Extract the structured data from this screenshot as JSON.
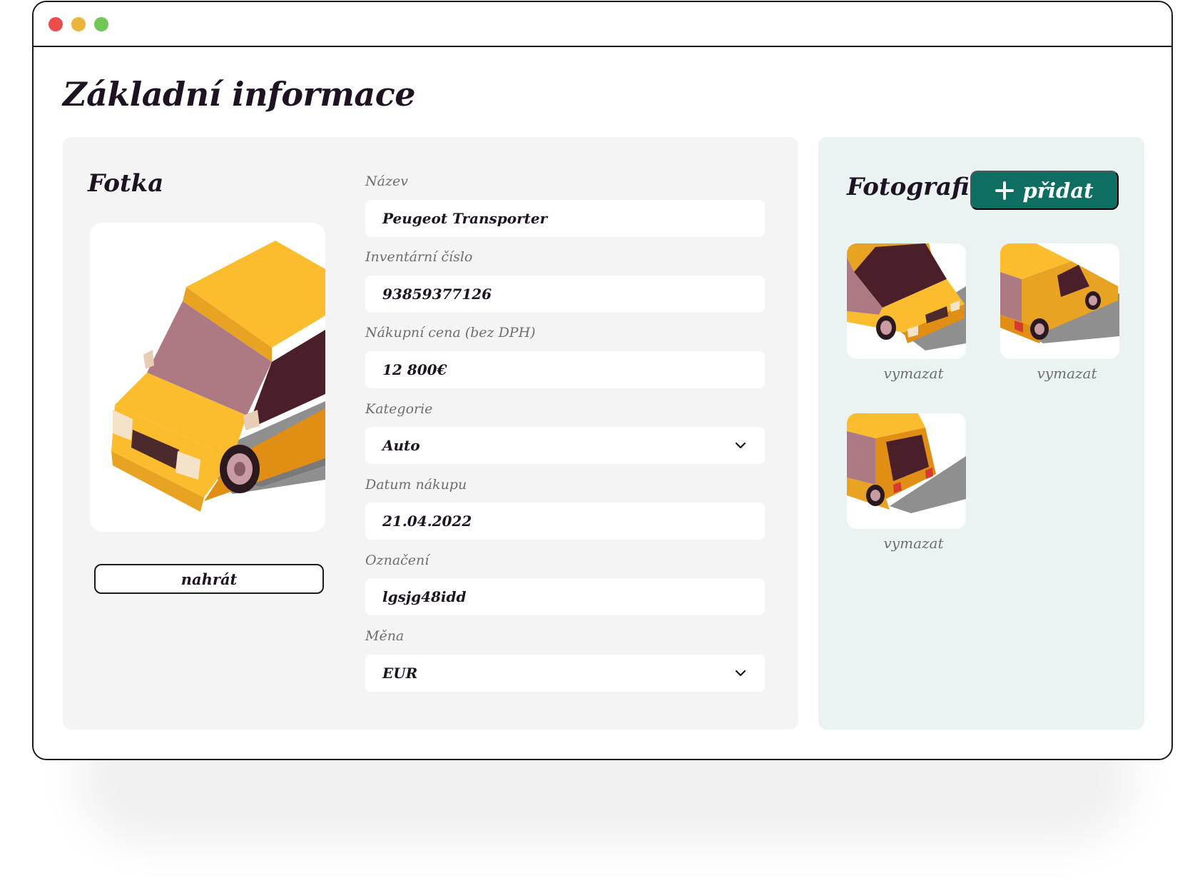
{
  "window": {
    "controls": [
      "close",
      "minimize",
      "maximize"
    ],
    "colors": {
      "close": "#ed4c4c",
      "minimize": "#e9b53c",
      "maximize": "#6fc855"
    }
  },
  "page": {
    "title": "Základní informace"
  },
  "photo": {
    "title": "Fotka",
    "upload_label": "nahrát"
  },
  "form": {
    "fields": [
      {
        "label": "Název",
        "value": "Peugeot Transporter",
        "type": "text"
      },
      {
        "label": "Inventární číslo",
        "value": "93859377126",
        "type": "text"
      },
      {
        "label": "Nákupní cena (bez DPH)",
        "value": "12 800€",
        "type": "text"
      },
      {
        "label": "Kategorie",
        "value": "Auto",
        "type": "select"
      },
      {
        "label": "Datum nákupu",
        "value": "21.04.2022",
        "type": "text"
      },
      {
        "label": "Označení",
        "value": "lgsjg48idd",
        "type": "text"
      },
      {
        "label": "Měna",
        "value": "EUR",
        "type": "select"
      }
    ]
  },
  "gallery": {
    "title": "Fotografie",
    "add_label": "přidat",
    "accent_color": "#0f6e62",
    "items": [
      {
        "view": "front",
        "delete_label": "vymazat"
      },
      {
        "view": "rear-side",
        "delete_label": "vymazat"
      },
      {
        "view": "rear",
        "delete_label": "vymazat"
      }
    ]
  }
}
